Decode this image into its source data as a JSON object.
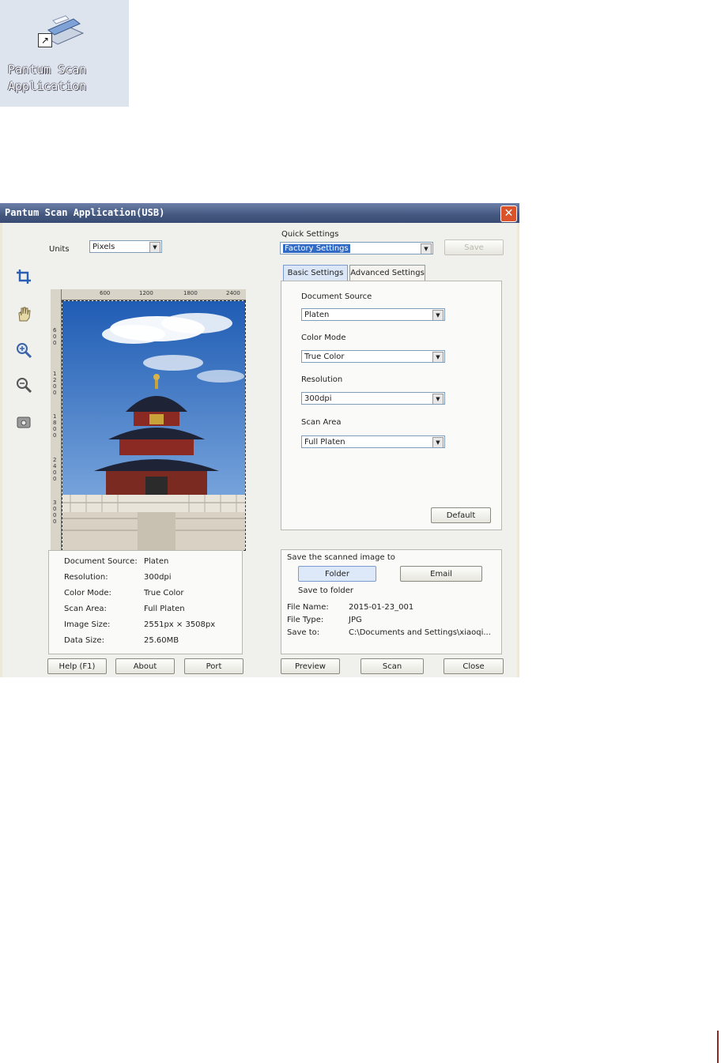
{
  "shortcut": {
    "label": "Pantum Scan Application",
    "icon": "scanner-shortcut-icon"
  },
  "window": {
    "title": "Pantum Scan Application(USB)",
    "close_icon": "close-icon"
  },
  "units": {
    "label": "Units",
    "value": "Pixels"
  },
  "ruler": {
    "unit": "px",
    "top_ticks": [
      "600",
      "1200",
      "1800",
      "2400"
    ],
    "left_ticks": [
      "600",
      "1200",
      "1800",
      "2400",
      "3000"
    ]
  },
  "tools": [
    "crop-icon",
    "hand-icon",
    "zoom-in-icon",
    "zoom-out-icon",
    "scanner-icon"
  ],
  "quick_settings": {
    "label": "Quick Settings",
    "value": "Factory Settings",
    "save_label": "Save"
  },
  "tabs": [
    {
      "label": "Basic Settings",
      "selected": true
    },
    {
      "label": "Advanced Settings",
      "selected": false
    }
  ],
  "basic": {
    "document_source": {
      "label": "Document Source",
      "value": "Platen"
    },
    "color_mode": {
      "label": "Color Mode",
      "value": "True Color"
    },
    "resolution": {
      "label": "Resolution",
      "value": "300dpi"
    },
    "scan_area": {
      "label": "Scan Area",
      "value": "Full Platen"
    },
    "default_label": "Default"
  },
  "info": [
    {
      "key": "Document Source:",
      "value": "Platen"
    },
    {
      "key": "Resolution:",
      "value": "300dpi"
    },
    {
      "key": "Color Mode:",
      "value": "True Color"
    },
    {
      "key": "Scan Area:",
      "value": "Full Platen"
    },
    {
      "key": "Image Size:",
      "value": "2551px × 3508px"
    },
    {
      "key": "Data Size:",
      "value": "25.60MB"
    }
  ],
  "save": {
    "title": "Save the scanned image to",
    "folder_label": "Folder",
    "email_label": "Email",
    "subtitle": "Save to folder",
    "rows": [
      {
        "key": "File Name:",
        "value": "2015-01-23_001"
      },
      {
        "key": "File Type:",
        "value": "JPG"
      },
      {
        "key": "Save to:",
        "value": "C:\\Documents and Settings\\xiaoqi..."
      }
    ]
  },
  "buttons": {
    "help": "Help (F1)",
    "about": "About",
    "port": "Port",
    "preview": "Preview",
    "scan": "Scan",
    "close": "Close"
  },
  "colors": {
    "title_bar": "#43577f",
    "close": "#d9542b",
    "selection": "#316ac5"
  }
}
